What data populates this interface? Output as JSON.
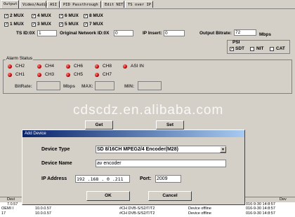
{
  "tabs": [
    "Output",
    "Video/Audio",
    "ASI",
    "PID Passthrough",
    "Edit NIT",
    "TS over IP"
  ],
  "mux_options": [
    "2 MUX",
    "4 MUX",
    "6 MUX",
    "8 MUX",
    "1 MUX",
    "3 MUX",
    "5 MUX",
    "7 MUX"
  ],
  "settings": {
    "ts_id_label": "TS ID:0X",
    "ts_id_value": "1",
    "onid_label": "Original Network ID:0X",
    "onid_value": "0",
    "ip_insert_label": "IP Insert:",
    "ip_insert_value": "0",
    "bitrate_label": "Output Bitrate:",
    "bitrate_value": "72",
    "bitrate_unit": "Mbps",
    "psi_label": "PSI",
    "psi_options": [
      "SDT",
      "NIT",
      "CAT"
    ]
  },
  "alarm": {
    "title": "Alarm Status",
    "channels": [
      "CH2",
      "CH4",
      "CH6",
      "CH8",
      "ASI IN",
      "CH1",
      "CH3",
      "CH5",
      "CH7"
    ],
    "bitrate_label": "BitRate:",
    "mbps": "Mbps",
    "max_label": "MAX:",
    "min_label": "MIN:"
  },
  "watermark": "cdscdz.en.alibaba.com",
  "buttons": {
    "get": "Get",
    "set": "Set"
  },
  "dialog": {
    "title": "Add Device",
    "device_type_label": "Device Type",
    "device_type_value": "SD 8/16CH MPEG2/4 Encoder(M28)",
    "device_name_label": "Device Name",
    "device_name_value": "av encoder",
    "ip_label": "IP Address",
    "ip_value": "192 .168 . 0 .211",
    "port_label": "Port:",
    "port_value": "2009",
    "ok": "OK",
    "cancel": "Cancel"
  },
  "log_rows": [
    {
      "col1": "Devi",
      "col2": "",
      "col3": "",
      "col4": "",
      "col5": "Dev"
    },
    {
      "col1": "7.0.57",
      "col2": "",
      "col3": "",
      "col4": "",
      "col5": "016-9-30 14:8:57"
    },
    {
      "col1": "OEMI I",
      "col2": "10.0.0.57",
      "col3": "#CH DVB-S/S2/T/T2",
      "col4": "Device offline",
      "col5": "016-9-30 14:8:57"
    },
    {
      "col1": "17",
      "col2": "10.0.0.57",
      "col3": "#CH DVB-S/S2/T/T2",
      "col4": "Device offline",
      "col5": "016-9-30 14:8:57"
    }
  ]
}
